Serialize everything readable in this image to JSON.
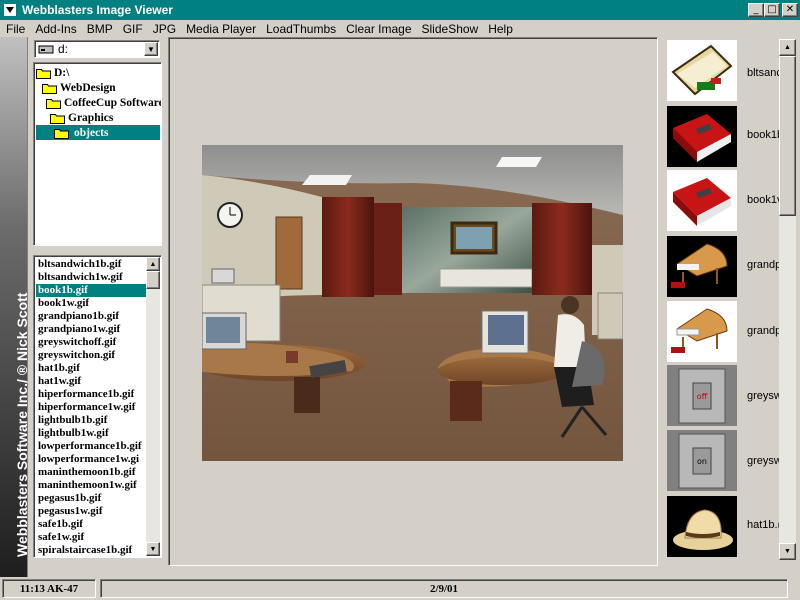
{
  "window": {
    "title": "Webblasters Image Viewer",
    "minimize": "_",
    "maximize": "□",
    "close": "✕"
  },
  "menu": [
    "File",
    "Add-Ins",
    "BMP",
    "GIF",
    "JPG",
    "Media Player",
    "LoadThumbs",
    "Clear Image",
    "SlideShow",
    "Help"
  ],
  "brand": "Webblasters Software Inc./ ® Nick Scott",
  "drive": {
    "value": "d:"
  },
  "tree": [
    {
      "label": "D:\\",
      "indent": 0,
      "selected": false
    },
    {
      "label": "WebDesign",
      "indent": 1,
      "selected": false
    },
    {
      "label": "CoffeeCup Software",
      "indent": 2,
      "selected": false
    },
    {
      "label": "Graphics",
      "indent": 3,
      "selected": false
    },
    {
      "label": "objects",
      "indent": 4,
      "selected": true
    }
  ],
  "files": [
    "bltsandwich1b.gif",
    "bltsandwich1w.gif",
    "book1b.gif",
    "book1w.gif",
    "grandpiano1b.gif",
    "grandpiano1w.gif",
    "greyswitchoff.gif",
    "greyswitchon.gif",
    "hat1b.gif",
    "hat1w.gif",
    "hiperformance1b.gif",
    "hiperformance1w.gif",
    "lightbulb1b.gif",
    "lightbulb1w.gif",
    "lowperformance1b.gif",
    "lowperformance1w.gi",
    "maninthemoon1b.gif",
    "maninthemoon1w.gif",
    "pegasus1b.gif",
    "pegasus1w.gif",
    "safe1b.gif",
    "safe1w.gif",
    "spiralstaircase1b.gif"
  ],
  "selected_file": "book1b.gif",
  "thumbnails": [
    {
      "label": "bltsanc",
      "icon": "sandwich-icon",
      "bg": "#ffffff"
    },
    {
      "label": "book1b",
      "icon": "book-icon",
      "bg": "#000000"
    },
    {
      "label": "book1v",
      "icon": "book-icon",
      "bg": "#ffffff"
    },
    {
      "label": "grandp",
      "icon": "piano-icon",
      "bg": "#000000"
    },
    {
      "label": "grandp",
      "icon": "piano-icon",
      "bg": "#ffffff"
    },
    {
      "label": "greysw",
      "icon": "switch-off-icon",
      "bg": "#808080"
    },
    {
      "label": "greysw",
      "icon": "switch-on-icon",
      "bg": "#808080"
    },
    {
      "label": "hat1b.(",
      "icon": "hat-icon",
      "bg": "#000000"
    }
  ],
  "switch": {
    "off": "off",
    "on": "on"
  },
  "status": {
    "left": "11:13 AK-47",
    "center": "2/9/01"
  },
  "colors": {
    "titlebar": "#008080",
    "selection": "#008080",
    "face": "#d4d0c8"
  }
}
